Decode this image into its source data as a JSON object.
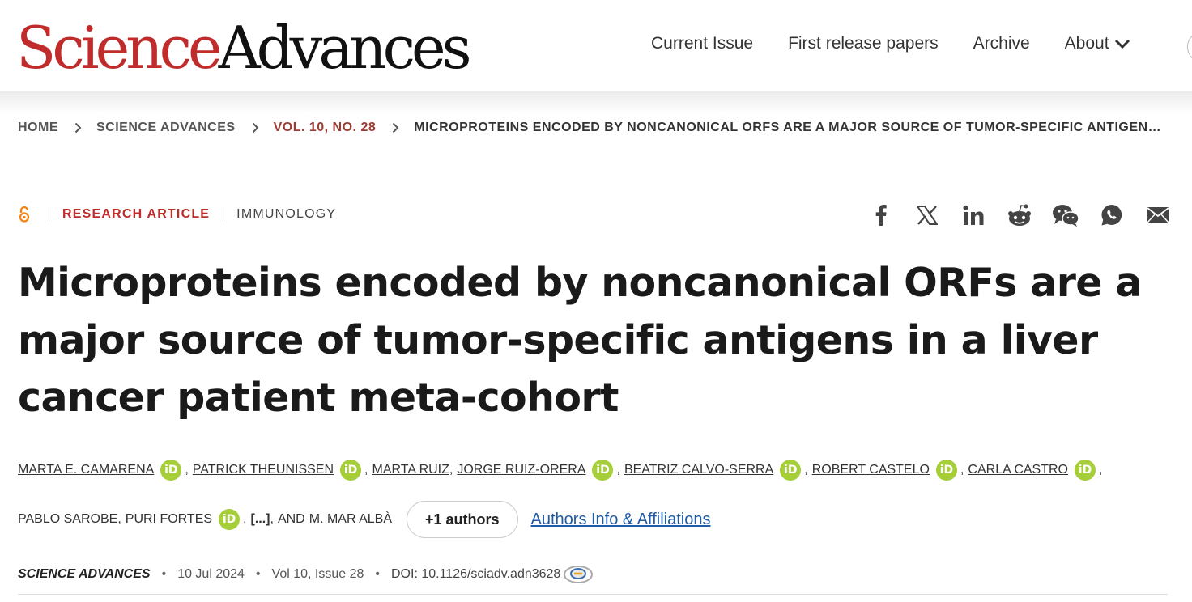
{
  "brand": {
    "logo_part1": "Science",
    "logo_part2": "Advances"
  },
  "nav": {
    "items": [
      {
        "label": "Current Issue"
      },
      {
        "label": "First release papers"
      },
      {
        "label": "Archive"
      },
      {
        "label": "About"
      }
    ]
  },
  "breadcrumb": [
    "HOME",
    "SCIENCE ADVANCES",
    "VOL. 10, NO. 28",
    "MICROPROTEINS ENCODED BY NONCANONICAL ORFS ARE A MAJOR SOURCE OF TUMOR-SPECIFIC ANTIGEN…"
  ],
  "article": {
    "type": "RESEARCH ARTICLE",
    "subject": "IMMUNOLOGY",
    "title": "Microproteins encoded by noncanonical ORFs are a major source of tumor-specific antigens in a liver can­cer patient meta-cohort"
  },
  "share_icons": [
    "facebook-icon",
    "x-icon",
    "linkedin-icon",
    "reddit-icon",
    "wechat-icon",
    "whatsapp-icon",
    "email-icon"
  ],
  "authors": {
    "line1": [
      "MARTA E. CAMARENA",
      "PATRICK THEUNISSEN",
      "MARTA RUIZ",
      "JORGE RUIZ-ORERA",
      "BEATRIZ CALVO-SERRA",
      "ROBERT CASTELO",
      "CARLA CASTRO"
    ],
    "line2": [
      "PABLO SAROBE",
      "PURI FORTES"
    ],
    "ellipsis": "[...]",
    "and": "AND",
    "last": "M. MAR ALBÀ",
    "orcid": "iD",
    "more_button": "+1 authors",
    "affiliations_link": "Authors Info & Affiliations"
  },
  "publication": {
    "journal": "SCIENCE ADVANCES",
    "date": "10 Jul 2024",
    "issue": "Vol 10, Issue 28",
    "doi": "DOI: 10.1126/sciadv.adn3628",
    "separator": "•"
  },
  "colors": {
    "brand_red": "#c02c2c",
    "vol_red": "#9b3b32",
    "orcid_green": "#a6ce39",
    "link_blue": "#1f5ca6",
    "oa_orange": "#f68212"
  }
}
